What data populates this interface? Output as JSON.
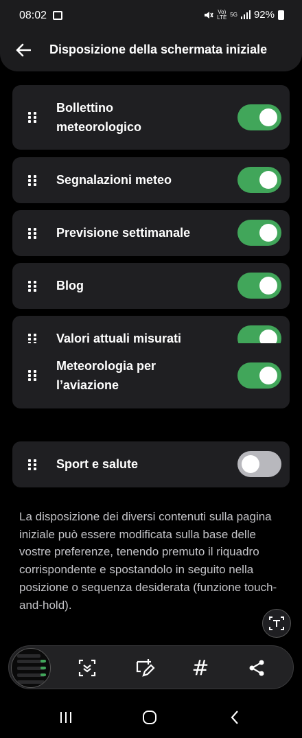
{
  "status_bar": {
    "time": "08:02",
    "volte": "Vo)",
    "lte": "LTE",
    "network": "5G",
    "battery": "92%"
  },
  "header": {
    "title": "Disposizione della schermata iniziale"
  },
  "items": [
    {
      "label_line1": "Bollettino",
      "label_line2": "meteorologico",
      "enabled": true
    },
    {
      "label": "Segnalazioni meteo",
      "enabled": true
    },
    {
      "label": "Previsione settimanale",
      "enabled": true
    },
    {
      "label": "Blog",
      "enabled": true
    },
    {
      "label": "Valori attuali misurati",
      "enabled": true
    },
    {
      "label_line1": "Meteorologia per",
      "label_line2": "l’aviazione",
      "enabled": true
    },
    {
      "label": "Sport e salute",
      "enabled": false
    }
  ],
  "description": "La disposizione dei diversi contenuti sulla pagina iniziale può essere modificata sulla base delle vostre preferenze, tenendo premuto il riquadro corrispondente e spostandolo in seguito nella posizione o sequenza desiderata (funzione touch-and-hold).",
  "toolbar": {
    "icons": [
      "scroll-capture-icon",
      "crop-edit-icon",
      "hashtag-icon",
      "share-icon"
    ],
    "tag_symbol": "#"
  },
  "colors": {
    "toggle_on": "#41a65a",
    "toggle_off": "#b8b8bd",
    "card": "#1f1f22",
    "background": "#000000"
  }
}
